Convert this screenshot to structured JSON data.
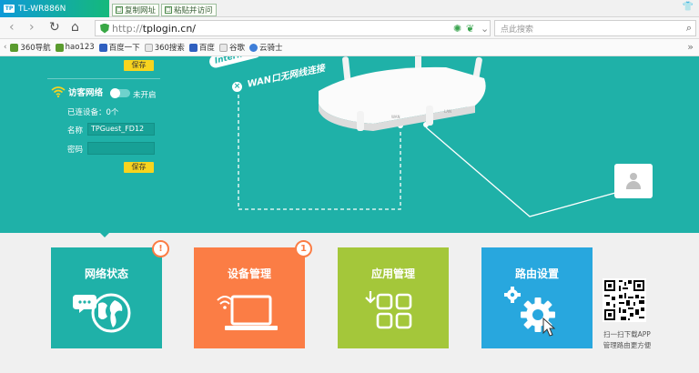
{
  "browser": {
    "tab_title": "TL-WR886N",
    "tab_favicon": "TP",
    "pill_copy": "复制网址",
    "pill_paste": "粘贴并访问",
    "url_scheme": "http://",
    "url_host": "tplogin.cn/",
    "search_placeholder": "点此搜索"
  },
  "bookmarks": [
    {
      "label": "360导航",
      "icon": "g"
    },
    {
      "label": "hao123",
      "icon": "g"
    },
    {
      "label": "百度一下",
      "icon": "b"
    },
    {
      "label": "360搜索",
      "icon": "o"
    },
    {
      "label": "百度",
      "icon": "b"
    },
    {
      "label": "谷歌",
      "icon": "o"
    },
    {
      "label": "云骑士",
      "icon": "c"
    }
  ],
  "panel": {
    "save_top": "保存",
    "guest_title": "访客网络",
    "toggle_state": "未开启",
    "connected": "已连设备：0个",
    "name_label": "名称",
    "name_value": "TPGuest_FD12",
    "pwd_label": "密码",
    "pwd_value": "",
    "save_bottom": "保存"
  },
  "diagram": {
    "internet": "Internet",
    "wan_status": "WAN口无网线连接"
  },
  "tiles": [
    {
      "label": "网络状态",
      "badge": "!",
      "color": "#1fb1a8"
    },
    {
      "label": "设备管理",
      "badge": "1",
      "color": "#fb7d45"
    },
    {
      "label": "应用管理",
      "badge": "",
      "color": "#a4c73a"
    },
    {
      "label": "路由设置",
      "badge": "",
      "color": "#28a7de"
    }
  ],
  "qr": {
    "caption1": "扫一扫下载APP",
    "caption2": "管理路由更方便"
  }
}
